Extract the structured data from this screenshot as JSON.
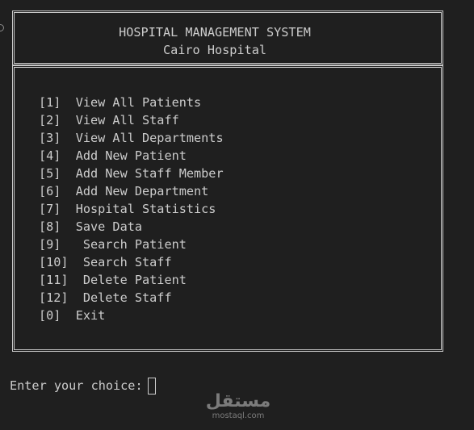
{
  "header": {
    "title": "HOSPITAL MANAGEMENT SYSTEM",
    "subtitle": "Cairo Hospital"
  },
  "menu": {
    "items": [
      {
        "text": "[1]  View All Patients"
      },
      {
        "text": "[2]  View All Staff"
      },
      {
        "text": "[3]  View All Departments"
      },
      {
        "text": "[4]  Add New Patient"
      },
      {
        "text": "[5]  Add New Staff Member"
      },
      {
        "text": "[6]  Add New Department"
      },
      {
        "text": "[7]  Hospital Statistics"
      },
      {
        "text": "[8]  Save Data"
      },
      {
        "text": "[9]   Search Patient"
      },
      {
        "text": "[10]  Search Staff"
      },
      {
        "text": "[11]  Delete Patient"
      },
      {
        "text": "[12]  Delete Staff"
      },
      {
        "text": "[0]  Exit"
      }
    ]
  },
  "prompt": {
    "label": "Enter your choice:",
    "value": ""
  },
  "watermark": {
    "arabic": "مستقل",
    "latin": "mostaql.com"
  }
}
